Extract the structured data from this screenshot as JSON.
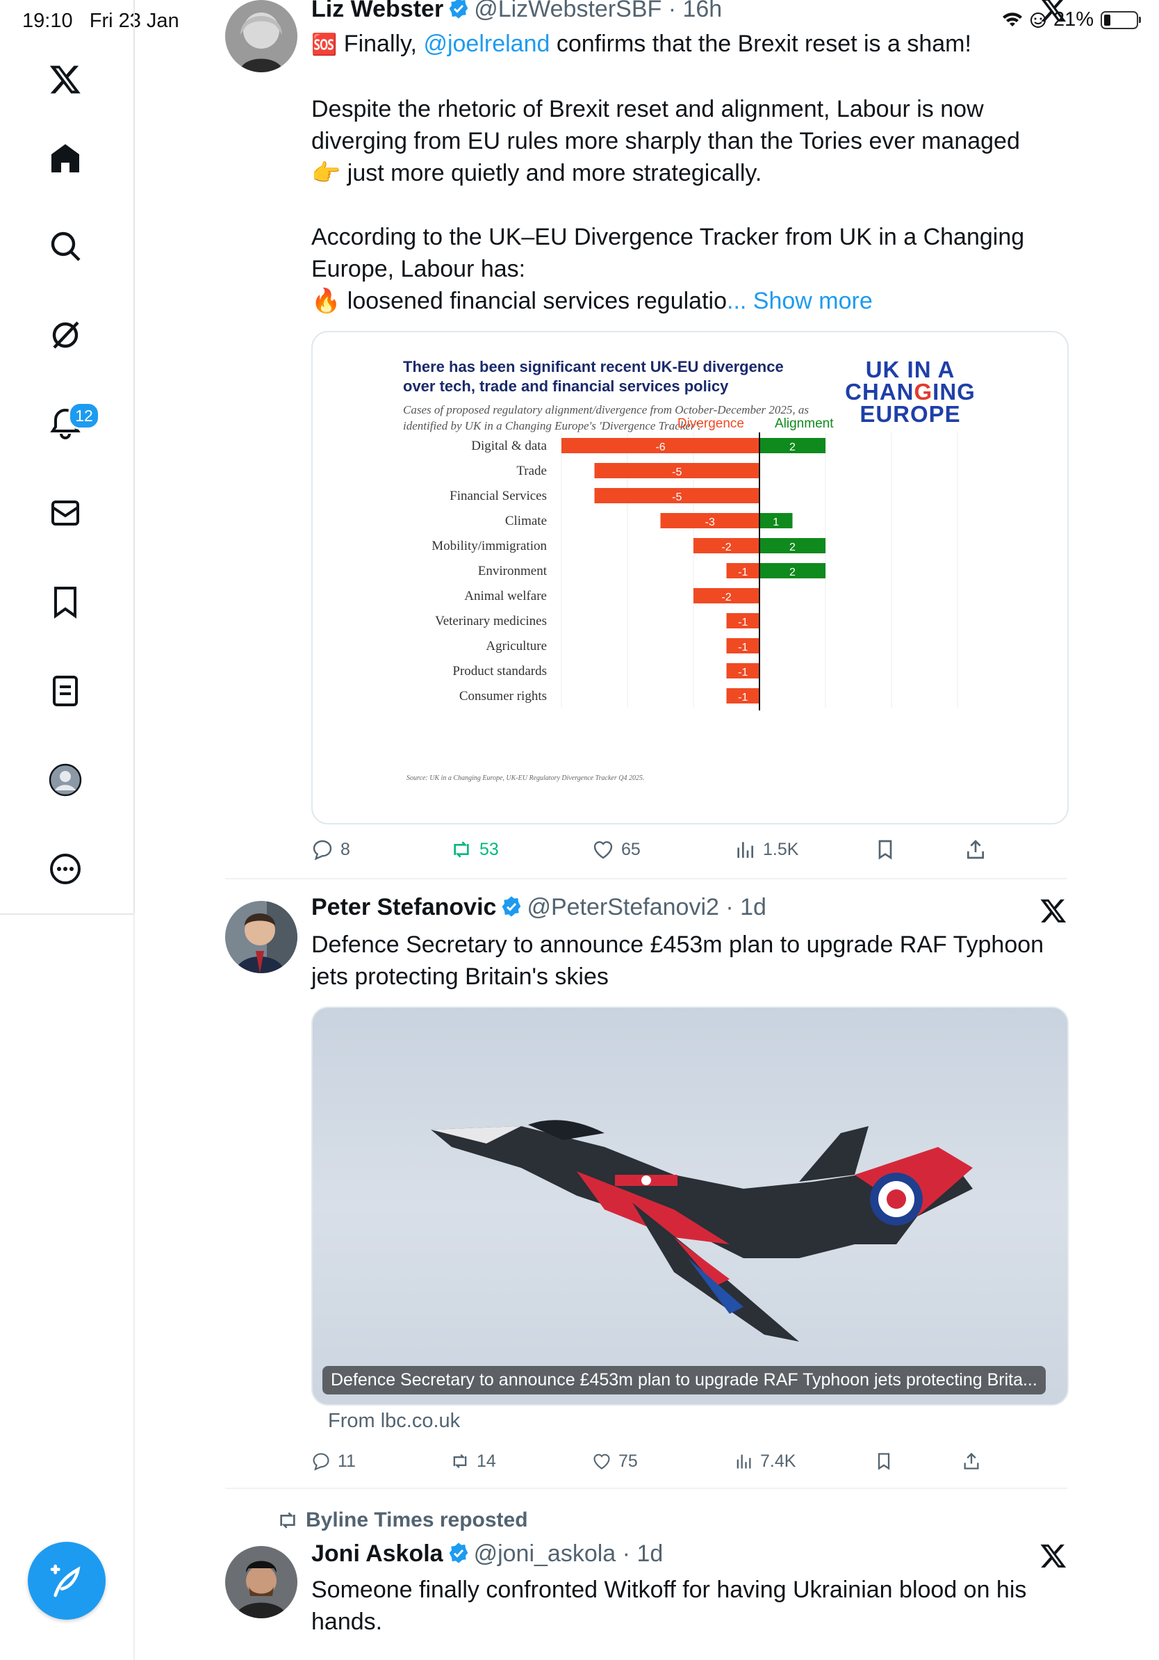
{
  "status_bar": {
    "time": "19:10",
    "date": "Fri 23 Jan",
    "battery": "21%"
  },
  "sidebar": {
    "notifications_badge": "12"
  },
  "tweet1": {
    "name": "Liz Webster",
    "handle": "@LizWebsterSBF",
    "time": "16h",
    "emoji_sos": "🆘",
    "text_a": " Finally, ",
    "mention": "@joelreland",
    "text_b": " confirms that the Brexit reset is a sham!",
    "para2": "Despite the rhetoric of  Brexit reset and alignment, Labour is now diverging from EU rules more sharply than the Tories ever managed 👉 just more quietly and more strategically.",
    "para3": "According to the UK–EU Divergence Tracker from UK in a Changing Europe, Labour has:",
    "para4": "🔥 loosened financial services regulatio",
    "show_more": "... Show more",
    "stats": {
      "replies": "8",
      "reposts": "53",
      "likes": "65",
      "views": "1.5K"
    }
  },
  "chart_header": {
    "title": "There has been significant recent UK-EU divergence over tech, trade and financial services policy",
    "subtitle": "Cases of proposed regulatory alignment/divergence from October-December 2025, as identified by UK in a Changing Europe's 'Divergence Tracker'.",
    "logo_line1": "UK IN A",
    "logo_line2a": "CHAN",
    "logo_line2b": "G",
    "logo_line2c": "ING",
    "logo_line3": "EUROPE",
    "source": "Source: UK in a Changing Europe, UK-EU Regulatory Divergence Tracker Q4 2025."
  },
  "chart_data": {
    "type": "bar",
    "orientation": "horizontal",
    "title": "There has been significant recent UK-EU divergence over tech, trade and financial services policy",
    "categories": [
      "Digital & data",
      "Trade",
      "Financial Services",
      "Climate",
      "Mobility/immigration",
      "Environment",
      "Animal welfare",
      "Veterinary medicines",
      "Agriculture",
      "Product standards",
      "Consumer rights"
    ],
    "series": [
      {
        "name": "Divergence",
        "color": "#f04a23",
        "values": [
          -6,
          -5,
          -5,
          -3,
          -2,
          -1,
          -2,
          -1,
          -1,
          -1,
          -1
        ],
        "labels": [
          "-6",
          "-5",
          "-5",
          "-3",
          "-2",
          "-1",
          "-2",
          "-1",
          "-1",
          "-1",
          "-1"
        ]
      },
      {
        "name": "Alignment",
        "color": "#0f8a1c",
        "values": [
          2,
          0,
          0,
          1,
          2,
          2,
          0,
          0,
          0,
          0,
          0
        ],
        "labels": [
          "2",
          "",
          "",
          "1",
          "2",
          "2",
          "",
          "",
          "",
          "",
          ""
        ]
      }
    ],
    "xlim": [
      -6,
      6
    ],
    "grid": true,
    "legend": "top"
  },
  "tweet2": {
    "name": "Peter Stefanovic",
    "handle": "@PeterStefanovi2",
    "time": "1d",
    "text": "Defence Secretary to announce £453m plan to upgrade RAF Typhoon jets protecting Britain's skies",
    "caption": "Defence Secretary to announce £453m plan to upgrade RAF Typhoon jets protecting Brita...",
    "from": "From lbc.co.uk",
    "stats": {
      "replies": "11",
      "reposts": "14",
      "likes": "75",
      "views": "7.4K"
    }
  },
  "tweet3": {
    "repost_label": "Byline Times reposted",
    "name": "Joni Askola",
    "handle": "@joni_askola",
    "time": "1d",
    "text": "Someone finally confronted Witkoff for having Ukrainian blood on his hands."
  },
  "icons": {
    "sidebar": [
      "x-logo-icon",
      "home-icon",
      "search-icon",
      "grok-icon",
      "bell-icon",
      "mail-icon",
      "bookmark-icon",
      "list-icon",
      "profile-icon",
      "more-icon"
    ],
    "brand": "#1d9bf0",
    "repost_green": "#00ba7c"
  }
}
